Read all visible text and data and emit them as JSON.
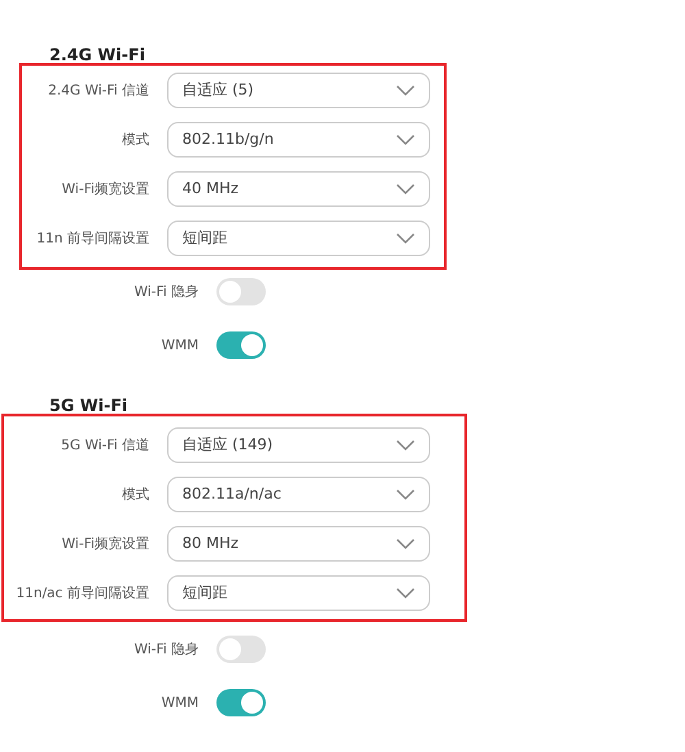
{
  "sections": [
    {
      "title": "2.4G Wi-Fi",
      "highlighted": true,
      "selects": [
        {
          "label": "2.4G Wi-Fi 信道",
          "value": "自适应 (5)"
        },
        {
          "label": "模式",
          "value": "802.11b/g/n"
        },
        {
          "label": "Wi-Fi频宽设置",
          "value": "40 MHz"
        },
        {
          "label": "11n 前导间隔设置",
          "value": "短间距"
        }
      ],
      "toggles": [
        {
          "label": "Wi-Fi 隐身",
          "on": false
        },
        {
          "label": "WMM",
          "on": true
        }
      ]
    },
    {
      "title": "5G Wi-Fi",
      "highlighted": true,
      "selects": [
        {
          "label": "5G Wi-Fi 信道",
          "value": "自适应 (149)"
        },
        {
          "label": "模式",
          "value": "802.11a/n/ac"
        },
        {
          "label": "Wi-Fi频宽设置",
          "value": "80 MHz"
        },
        {
          "label": "11n/ac 前导间隔设置",
          "value": "短间距"
        }
      ],
      "toggles": [
        {
          "label": "Wi-Fi 隐身",
          "on": false
        },
        {
          "label": "WMM",
          "on": true
        }
      ]
    }
  ]
}
